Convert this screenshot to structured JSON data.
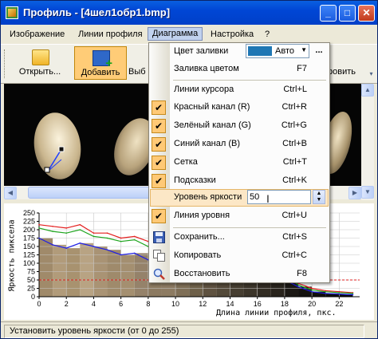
{
  "window": {
    "title": "Профиль - [4шел1обр1.bmp]",
    "controls": {
      "minimize": "_",
      "maximize": "□",
      "close": "✕"
    }
  },
  "menubar": {
    "items": [
      "Изображение",
      "Линии профиля",
      "Диаграмма",
      "Настройка",
      "?"
    ],
    "active": "Диаграмма"
  },
  "toolbar": {
    "open_label": "Открыть...",
    "add_label": "Добавить",
    "cut_label": "Выб",
    "save_label": "ровить",
    "icons": [
      "folder-icon",
      "add-profile-icon"
    ]
  },
  "dropdown": {
    "fill_color": {
      "label": "Цвет заливки",
      "value": "Авто",
      "swatch": "#1f77b4",
      "more": "..."
    },
    "fill": {
      "label": "Заливка цветом",
      "shortcut": "F7"
    },
    "cursor_lines": {
      "label": "Линии курсора",
      "shortcut": "Ctrl+L"
    },
    "red": {
      "label": "Красный канал (R)",
      "shortcut": "Ctrl+R",
      "checked": true
    },
    "green": {
      "label": "Зелёный канал (G)",
      "shortcut": "Ctrl+G",
      "checked": true
    },
    "blue": {
      "label": "Синий канал (B)",
      "shortcut": "Ctrl+B",
      "checked": true
    },
    "grid": {
      "label": "Сетка",
      "shortcut": "Ctrl+T",
      "checked": true
    },
    "hints": {
      "label": "Подсказки",
      "shortcut": "Ctrl+K",
      "checked": true
    },
    "brightness": {
      "label": "Уровень яркости",
      "value": "50"
    },
    "level_line": {
      "label": "Линия уровня",
      "shortcut": "Ctrl+U",
      "checked": true
    },
    "save": {
      "label": "Сохранить...",
      "shortcut": "Ctrl+S"
    },
    "copy": {
      "label": "Копировать",
      "shortcut": "Ctrl+C"
    },
    "restore": {
      "label": "Восстановить",
      "shortcut": "F8"
    },
    "check_glyph": "✔"
  },
  "status": {
    "text": "Установить уровень яркости (от 0 до 255)"
  },
  "chart_data": {
    "type": "line",
    "xlabel": "Длина линии профиля, пкс.",
    "ylabel": "Яркость пиксела",
    "xlim": [
      0,
      23.5
    ],
    "ylim": [
      0,
      250
    ],
    "yticks": [
      0,
      25,
      50,
      75,
      100,
      125,
      150,
      175,
      200,
      225,
      250
    ],
    "xticks": [
      0,
      2,
      4,
      6,
      8,
      10,
      12,
      14,
      16,
      18,
      20,
      22
    ],
    "grid": true,
    "level_line": 50,
    "x": [
      0,
      1,
      2,
      3,
      4,
      5,
      6,
      7,
      8,
      9,
      10,
      11,
      12,
      13,
      14,
      15,
      16,
      17,
      18,
      19,
      20,
      21,
      22,
      23
    ],
    "series": [
      {
        "name": "Красный канал (R)",
        "color": "#e41e1e",
        "values": [
          215,
          210,
          205,
          215,
          190,
          190,
          175,
          180,
          165,
          160,
          155,
          150,
          140,
          130,
          115,
          105,
          95,
          90,
          85,
          40,
          25,
          18,
          15,
          12
        ]
      },
      {
        "name": "Зелёный канал (G)",
        "color": "#1ea51e",
        "values": [
          205,
          195,
          190,
          200,
          180,
          175,
          165,
          170,
          150,
          145,
          140,
          130,
          120,
          110,
          100,
          95,
          85,
          75,
          70,
          35,
          20,
          15,
          12,
          10
        ]
      },
      {
        "name": "Синий канал (B)",
        "color": "#1e1ee6",
        "values": [
          175,
          155,
          145,
          160,
          150,
          140,
          125,
          130,
          110,
          105,
          100,
          95,
          85,
          80,
          70,
          65,
          60,
          55,
          50,
          30,
          15,
          10,
          8,
          6
        ]
      }
    ]
  }
}
